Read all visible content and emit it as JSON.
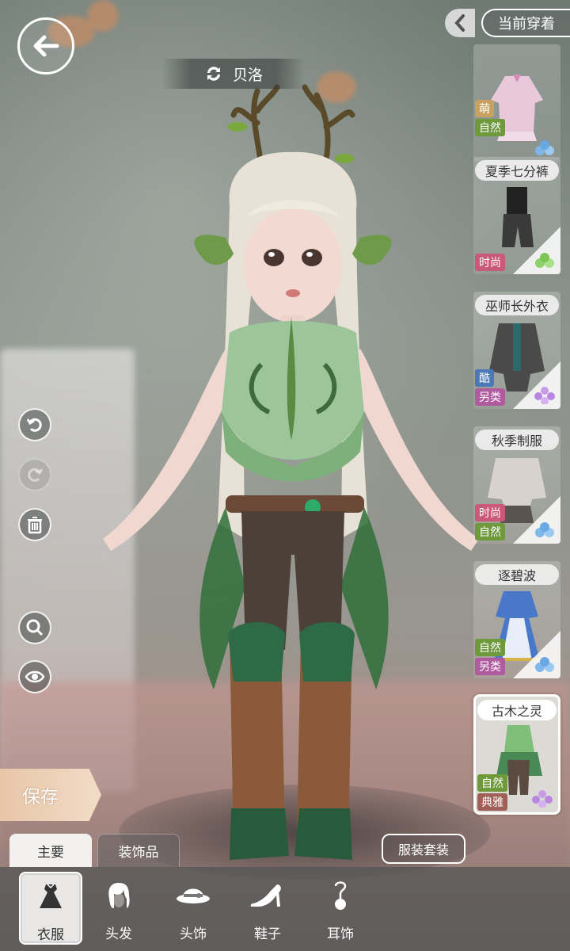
{
  "header": {
    "character_name": "贝洛",
    "current_wear_label": "当前穿着"
  },
  "outfits": [
    {
      "title": "",
      "tags": [
        "萌",
        "自然"
      ],
      "tag_types": [
        "cute",
        "natural"
      ],
      "gem_color": "#7fb7ea",
      "selected": false
    },
    {
      "title": "夏季七分裤",
      "tags": [
        "时尚"
      ],
      "tag_types": [
        "fashion"
      ],
      "gem_color": "#8fd06a",
      "selected": false
    },
    {
      "title": "巫师长外衣",
      "tags": [
        "酷",
        "另类"
      ],
      "tag_types": [
        "cool",
        "alt"
      ],
      "gem_color": "#c79be8",
      "selected": false
    },
    {
      "title": "秋季制服",
      "tags": [
        "时尚",
        "自然"
      ],
      "tag_types": [
        "fashion",
        "natural"
      ],
      "gem_color": "#7fb7ea",
      "selected": false
    },
    {
      "title": "逐碧波",
      "tags": [
        "自然",
        "另类"
      ],
      "tag_types": [
        "natural",
        "alt"
      ],
      "gem_color": "#7fb7ea",
      "selected": false
    },
    {
      "title": "古木之灵",
      "tags": [
        "自然",
        "典雅"
      ],
      "tag_types": [
        "natural",
        "elegant"
      ],
      "gem_color": "#c79be8",
      "selected": true
    }
  ],
  "actions": {
    "save_label": "保存",
    "suit_label": "服装套装"
  },
  "tabs": {
    "main_label": "主要",
    "accessories_label": "装饰品"
  },
  "categories": [
    {
      "label": "衣服",
      "icon": "dress-icon",
      "active": true
    },
    {
      "label": "头发",
      "icon": "hair-icon",
      "active": false
    },
    {
      "label": "头饰",
      "icon": "hat-icon",
      "active": false
    },
    {
      "label": "鞋子",
      "icon": "high-heel-icon",
      "active": false
    },
    {
      "label": "耳饰",
      "icon": "earring-icon",
      "active": false
    }
  ],
  "tools": [
    "undo-icon",
    "redo-icon",
    "trash-icon",
    "zoom-icon",
    "eye-icon"
  ],
  "colors": {
    "save_button": "#f0d6bf",
    "tag_natural": "#6f9a3c",
    "tag_fashion": "#c85a78",
    "tag_cool": "#4a78b8",
    "tag_alt": "#b05aa0",
    "tag_cute": "#c8a060",
    "tag_elegant": "#a06058"
  }
}
